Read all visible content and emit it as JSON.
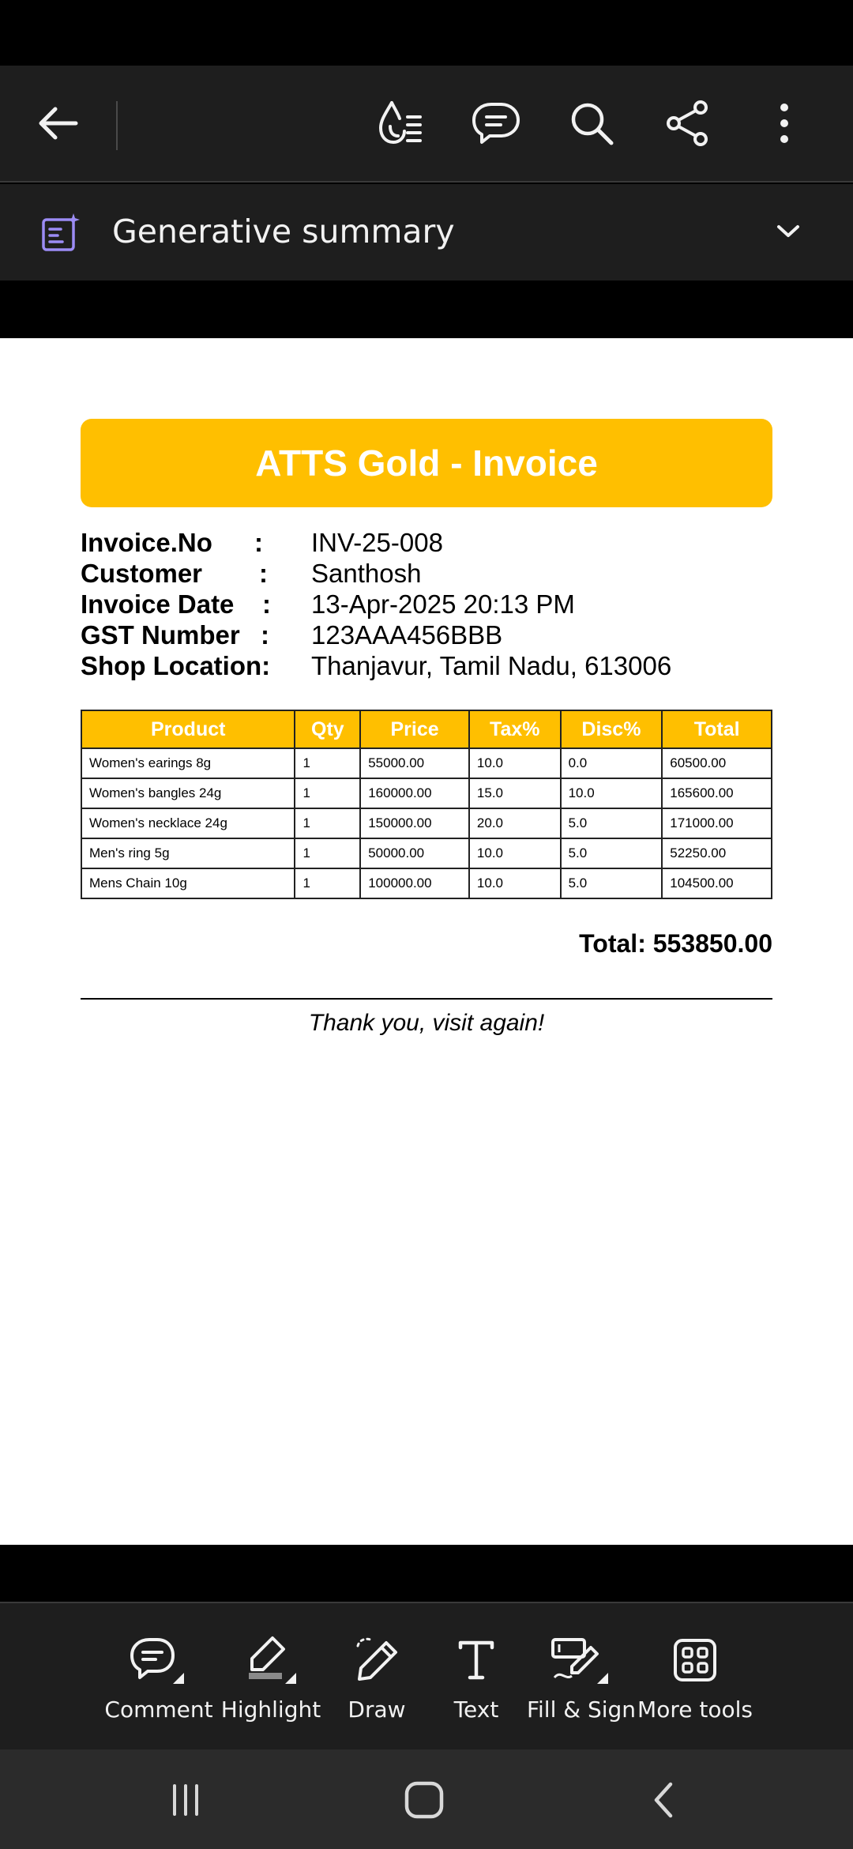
{
  "toolbar": {
    "icons": [
      "back-arrow-icon",
      "liquid-mode-icon",
      "comment-list-icon",
      "search-icon",
      "share-icon",
      "more-vert-icon"
    ]
  },
  "summary": {
    "label": "Generative summary",
    "icon": "generative-summary-icon",
    "expand_icon": "chevron-down-icon"
  },
  "invoice": {
    "title": "ATTS Gold - Invoice",
    "brand_color": "#ffbf00",
    "fields": [
      {
        "label": "Invoice.No",
        "colon": ":",
        "value": "INV-25-008"
      },
      {
        "label": "Customer",
        "colon": ":",
        "value": "Santhosh"
      },
      {
        "label": "Invoice Date",
        "colon": ":",
        "value": "13-Apr-2025 20:13 PM"
      },
      {
        "label": "GST Number",
        "colon": ":",
        "value": "123AAA456BBB"
      },
      {
        "label": "Shop Location:",
        "colon": "",
        "value": "Thanjavur, Tamil Nadu, 613006"
      }
    ],
    "table": {
      "headers": [
        "Product",
        "Qty",
        "Price",
        "Tax%",
        "Disc%",
        "Total"
      ],
      "rows": [
        [
          "Women's earings 8g",
          "1",
          "55000.00",
          "10.0",
          "0.0",
          "60500.00"
        ],
        [
          "Women's bangles 24g",
          "1",
          "160000.00",
          "15.0",
          "10.0",
          "165600.00"
        ],
        [
          "Women's necklace 24g",
          "1",
          "150000.00",
          "20.0",
          "5.0",
          "171000.00"
        ],
        [
          "Men's ring 5g",
          "1",
          "50000.00",
          "10.0",
          "5.0",
          "52250.00"
        ],
        [
          "Mens Chain 10g",
          "1",
          "100000.00",
          "10.0",
          "5.0",
          "104500.00"
        ]
      ]
    },
    "total": "Total: 553850.00",
    "thanks": "Thank you, visit again!"
  },
  "tools": [
    {
      "label": "Comment",
      "icon": "comment-icon"
    },
    {
      "label": "Highlight",
      "icon": "highlight-icon"
    },
    {
      "label": "Draw",
      "icon": "draw-icon"
    },
    {
      "label": "Text",
      "icon": "text-icon"
    },
    {
      "label": "Fill & Sign",
      "icon": "fill-sign-icon"
    },
    {
      "label": "More tools",
      "icon": "more-tools-icon"
    }
  ],
  "nav": {
    "icons": [
      "recents-icon",
      "home-icon",
      "back-icon"
    ]
  }
}
